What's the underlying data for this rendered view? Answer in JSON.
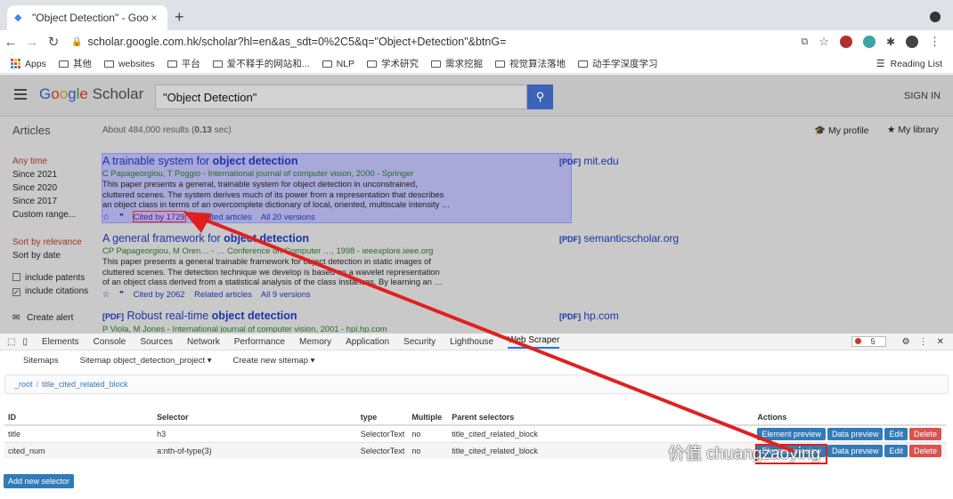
{
  "browser": {
    "tab_title": "\"Object Detection\" - Google Sc",
    "tab_close": "×",
    "new_tab": "+",
    "url": "scholar.google.com.hk/scholar?hl=en&as_sdt=0%2C5&q=\"Object+Detection\"&btnG=",
    "bookmarks": [
      "Apps",
      "其他",
      "websites",
      "平台",
      "爱不释手的网站和...",
      "NLP",
      "学术研究",
      "需求挖掘",
      "视觉算法落地",
      "动手学深度学习"
    ],
    "reading_list": "Reading List"
  },
  "scholar": {
    "logo": "Google Scholar",
    "query": "\"Object Detection\"",
    "sign_in": "SIGN IN",
    "articles_label": "Articles",
    "about": "About 484,000 results (",
    "about_time": "0.13",
    "about_end": " sec)",
    "my_profile": "My profile",
    "my_library": "My library",
    "time_filters": [
      "Any time",
      "Since 2021",
      "Since 2020",
      "Since 2017",
      "Custom range..."
    ],
    "sort": [
      "Sort by relevance",
      "Sort by date"
    ],
    "checks": [
      "include patents",
      "include citations"
    ],
    "create_alert": "Create alert",
    "results": [
      {
        "title_pre": "A trainable system for ",
        "title_bold": "object detection",
        "authors": "C Papageorgiou, T Poggio - International journal of computer vision, 2000 - Springer",
        "snippet": [
          "This paper presents a general, trainable system for object detection in unconstrained,",
          "cluttered scenes. The system derives much of its power from a representation that describes",
          "an object class in terms of an overcomplete dictionary of local, oriented, multiscale intensity …"
        ],
        "cited": "Cited by 1729",
        "related": "Related articles",
        "versions": "All 20 versions",
        "pdf_tag": "[PDF]",
        "pdf_site": "mit.edu"
      },
      {
        "title_pre": "A general framework for ",
        "title_bold": "object detection",
        "authors": "CP Papageorgiou, M Oren… - … Conference on Computer …, 1998 - ieeexplore.ieee.org",
        "snippet": [
          "This paper presents a general trainable framework for object detection in static images of",
          "cluttered scenes. The detection technique we develop is based on a wavelet representation",
          "of an object class derived from a statistical analysis of the class instances. By learning an …"
        ],
        "cited": "Cited by 2062",
        "related": "Related articles",
        "versions": "All 9 versions",
        "pdf_tag": "[PDF]",
        "pdf_site": "semanticscholar.org"
      },
      {
        "title_tag": "[PDF]",
        "title_pre": "Robust real-time ",
        "title_bold": "object detection",
        "authors": "P Viola, M Jones - International journal of computer vision, 2001 - hpl.hp.com",
        "pdf_tag": "[PDF]",
        "pdf_site": "hp.com"
      }
    ]
  },
  "devtools": {
    "tabs": [
      "Elements",
      "Console",
      "Sources",
      "Network",
      "Performance",
      "Memory",
      "Application",
      "Security",
      "Lighthouse",
      "Web Scraper"
    ],
    "error_count": "5",
    "subnav": [
      "Sitemaps",
      "Sitemap object_detection_project ▾",
      "Create new sitemap ▾"
    ],
    "breadcrumb": [
      "_root",
      "title_cited_related_block"
    ],
    "columns": [
      "ID",
      "Selector",
      "type",
      "Multiple",
      "Parent selectors",
      "Actions"
    ],
    "rows": [
      {
        "id": "title",
        "selector": "h3",
        "type": "SelectorText",
        "multiple": "no",
        "parent": "title_cited_related_block"
      },
      {
        "id": "cited_num",
        "selector": "a:nth-of-type(3)",
        "type": "SelectorText",
        "multiple": "no",
        "parent": "title_cited_related_block"
      }
    ],
    "actions": [
      "Element preview",
      "Data preview",
      "Edit",
      "Delete"
    ],
    "add_selector": "Add new selector"
  },
  "watermark": "价值 chuangzaoying",
  "colors": {
    "accent": "#337ab7",
    "danger": "#d9534f",
    "scholar_link": "#1a34a8",
    "arrow": "#e02020"
  }
}
